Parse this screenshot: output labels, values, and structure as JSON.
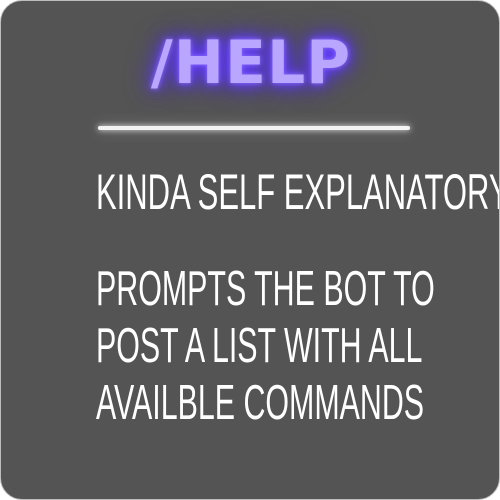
{
  "card": {
    "command": "/HELP",
    "subtitle": "KINDA SELF EXPLANATORY",
    "description_lines": [
      "PROMPTS THE BOT TO",
      "POST A LIST WITH ALL",
      "AVAILBLE COMMANDS"
    ]
  },
  "colors": {
    "background": "#545454",
    "command_text": "#b9a6ff",
    "command_glow": "#6f4bff",
    "divider": "#f4f4f4",
    "body_text": "#ffffff"
  }
}
